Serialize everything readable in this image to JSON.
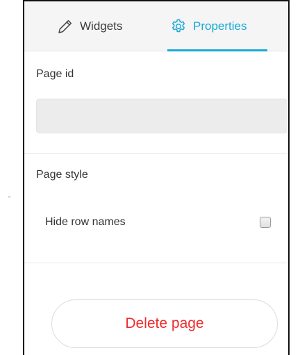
{
  "tabs": {
    "widgets": {
      "label": "Widgets",
      "icon": "pencil-icon"
    },
    "properties": {
      "label": "Properties",
      "icon": "gear-icon",
      "active": true
    }
  },
  "page_id": {
    "label": "Page id",
    "value": "",
    "placeholder": ""
  },
  "page_style": {
    "label": "Page style",
    "options": [
      {
        "label": "Hide row names",
        "checked": false
      }
    ]
  },
  "actions": {
    "delete_label": "Delete page"
  },
  "colors": {
    "accent": "#16a9d6",
    "danger": "#ef2b2b",
    "input_bg": "#ececec",
    "divider": "#e6e6e6"
  }
}
